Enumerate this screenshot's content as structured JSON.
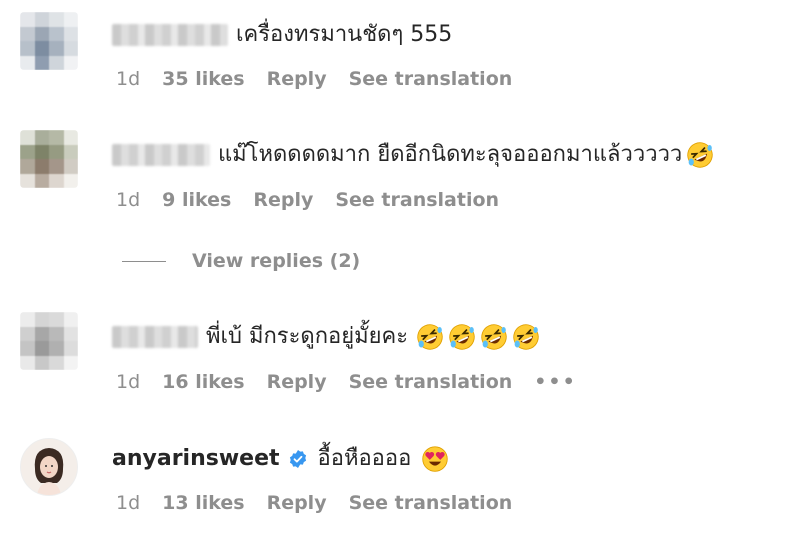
{
  "comments": [
    {
      "user": "",
      "text": "เครื่องทรมานชัดๆ 555",
      "time": "1d",
      "likes": "35 likes",
      "reply": "Reply",
      "translate": "See translation",
      "emojis": []
    },
    {
      "user": "",
      "text": "แม๊โหดดดดมาก ยืดอีกนิดทะลุจอออกมาแล้ววววว",
      "time": "1d",
      "likes": "9 likes",
      "reply": "Reply",
      "translate": "See translation",
      "emojis": [
        "rolling-on-floor-laughing"
      ]
    },
    {
      "user": "",
      "text": "พี่เบ้ มีกระดูกอยู่มั้ยคะ",
      "time": "1d",
      "likes": "16 likes",
      "reply": "Reply",
      "translate": "See translation",
      "more": "•••",
      "emojis": [
        "rolling-on-floor-laughing",
        "rolling-on-floor-laughing",
        "rolling-on-floor-laughing",
        "rolling-on-floor-laughing"
      ]
    },
    {
      "user": "anyarinsweet",
      "verified": true,
      "text": "อื้อหืออออ",
      "time": "1d",
      "likes": "13 likes",
      "reply": "Reply",
      "translate": "See translation",
      "emojis": [
        "heart-eyes"
      ]
    }
  ],
  "view_replies": {
    "label": "View replies (2)"
  },
  "colors": {
    "meta": "#8e8e8e",
    "text": "#262626",
    "verified": "#3897f0",
    "emoji": "#ffcc33"
  }
}
